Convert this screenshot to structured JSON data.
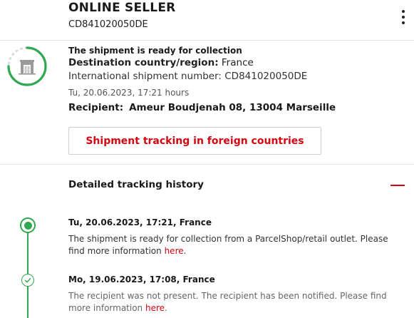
{
  "header": {
    "seller_name": "ONLINE SELLER",
    "shipment_number": "CD841020050DE"
  },
  "status": {
    "title": "The shipment is ready for collection",
    "destination_label": "Destination country/region:",
    "destination_value": " France",
    "international_number": "International shipment number: CD841020050DE",
    "datetime": "Tu, 20.06.2023, 17:21 hours",
    "recipient_label": "Recipient:",
    "recipient_value": "Ameur Boudjenah 08, 13004 Marseille",
    "progress_fraction": 0.75
  },
  "tracking_button_label": "Shipment tracking in foreign countries",
  "history": {
    "title": "Detailed tracking history",
    "events": [
      {
        "date": "Tu, 20.06.2023, 17:21, France",
        "text": "The shipment is ready for collection from a ParcelShop/retail outlet. Please find more information ",
        "link": "here",
        "suffix": "."
      },
      {
        "date": "Mo, 19.06.2023, 17:08, France",
        "text": "The recipient was not present. The recipient has been notified. Please find more information ",
        "link": "here",
        "suffix": "."
      }
    ]
  },
  "colors": {
    "accent_red": "#d40511",
    "status_green": "#2fa84f",
    "icon_grey": "#9a9a9a"
  },
  "icons": {
    "status": "parcelshop-store-icon",
    "menu": "more-vertical-icon",
    "collapse": "minus-icon",
    "check": "check-icon"
  }
}
